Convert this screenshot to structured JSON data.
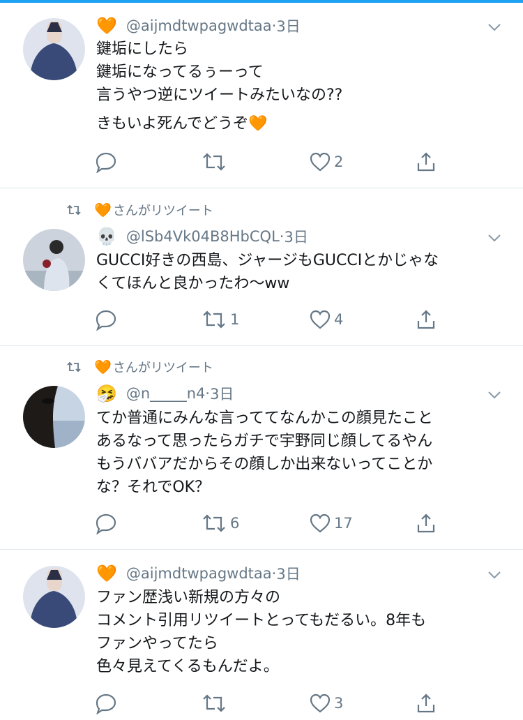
{
  "retweet_label": "さんがリツイート",
  "tweets": [
    {
      "retweeted_by_emoji": "",
      "emoji": "🧡",
      "handle": "@aijmdtwpagwdtaa",
      "time": "3日",
      "lines": [
        "鍵垢にしたら",
        "鍵垢になってるぅーって",
        "言うやつ逆にツイートみたいなの??",
        "きもいよ死んでどうぞ🧡"
      ],
      "replies": "",
      "retweets": "",
      "likes": "2"
    },
    {
      "retweeted_by_emoji": "🧡",
      "emoji": "💀",
      "handle": "@lSb4Vk04B8HbCQL",
      "time": "3日",
      "lines": [
        "GUCCI好きの西島、ジャージもGUCCIとかじゃな",
        "くてほんと良かったわ〜ww"
      ],
      "replies": "",
      "retweets": "1",
      "likes": "4"
    },
    {
      "retweeted_by_emoji": "🧡",
      "emoji": "🤧",
      "handle": "@n_____n4",
      "time": "3日",
      "lines": [
        "てか普通にみんな言っててなんかこの顔見たこと",
        "あるなって思ったらガチで宇野同じ顔してるやん",
        "もうババアだからその顔しか出来ないってことか",
        "な？それでOK？"
      ],
      "replies": "",
      "retweets": "6",
      "likes": "17"
    },
    {
      "retweeted_by_emoji": "",
      "emoji": "🧡",
      "handle": "@aijmdtwpagwdtaa",
      "time": "3日",
      "lines": [
        "ファン歴浅い新規の方々の",
        "コメント引用リツイートとってもだるい。8年も",
        "ファンやってたら",
        "色々見えてくるもんだよ。"
      ],
      "replies": "",
      "retweets": "",
      "likes": "3"
    }
  ]
}
